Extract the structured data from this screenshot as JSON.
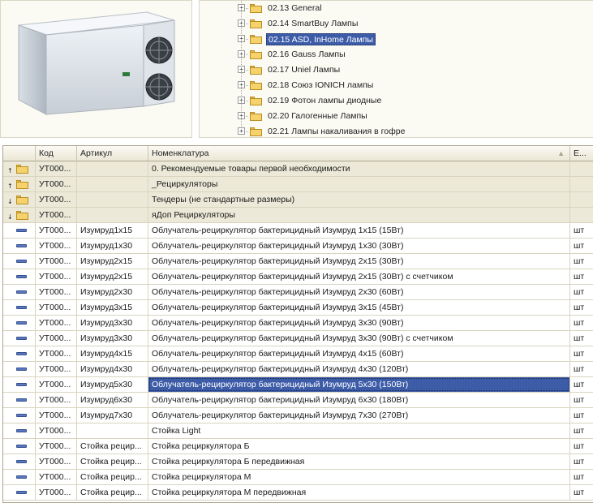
{
  "tree": {
    "items": [
      {
        "label": "02.13 General",
        "selected": false
      },
      {
        "label": "02.14 SmartBuy Лампы",
        "selected": false
      },
      {
        "label": "02.15 ASD, InHome Лампы",
        "selected": true
      },
      {
        "label": "02.16 Gauss Лампы",
        "selected": false
      },
      {
        "label": "02.17 Uniel Лампы",
        "selected": false
      },
      {
        "label": "02.18 Союз IONICH лампы",
        "selected": false
      },
      {
        "label": "02.19 Фотон лампы диодные",
        "selected": false
      },
      {
        "label": "02.20 Галогенные Лампы",
        "selected": false
      },
      {
        "label": "02.21 Лампы накаливания в гофре",
        "selected": false
      }
    ],
    "expander_glyph": "+"
  },
  "grid": {
    "columns": {
      "code": "Код",
      "article": "Артикул",
      "name": "Номенклатура",
      "unit": "Е..."
    },
    "sort_glyph": "▲",
    "rows": [
      {
        "kind": "group-up",
        "code": "УТ000...",
        "article": "",
        "name": "0. Рекомендуемые товары первой необходимости",
        "unit": ""
      },
      {
        "kind": "group-up",
        "code": "УТ000...",
        "article": "",
        "name": "_Рециркуляторы",
        "unit": ""
      },
      {
        "kind": "group-down",
        "code": "УТ000...",
        "article": "",
        "name": "Тендеры (не стандартные размеры)",
        "unit": ""
      },
      {
        "kind": "group-down",
        "code": "УТ000...",
        "article": "",
        "name": "яДоп Рециркуляторы",
        "unit": ""
      },
      {
        "kind": "item",
        "code": "УТ000...",
        "article": "Изумруд1x15",
        "name": "Облучатель-рециркулятор бактерицидный Изумруд 1x15 (15Вт)",
        "unit": "шт"
      },
      {
        "kind": "item",
        "code": "УТ000...",
        "article": "Изумруд1x30",
        "name": "Облучатель-рециркулятор бактерицидный Изумруд 1x30 (30Вт)",
        "unit": "шт"
      },
      {
        "kind": "item",
        "code": "УТ000...",
        "article": "Изумруд2x15",
        "name": "Облучатель-рециркулятор бактерицидный Изумруд 2x15 (30Вт)",
        "unit": "шт"
      },
      {
        "kind": "item",
        "code": "УТ000...",
        "article": "Изумруд2x15",
        "name": "Облучатель-рециркулятор бактерицидный Изумруд 2x15 (30Вт) с счетчиком",
        "unit": "шт"
      },
      {
        "kind": "item",
        "code": "УТ000...",
        "article": "Изумруд2x30",
        "name": "Облучатель-рециркулятор бактерицидный Изумруд 2x30 (60Вт)",
        "unit": "шт"
      },
      {
        "kind": "item",
        "code": "УТ000...",
        "article": "Изумруд3x15",
        "name": "Облучатель-рециркулятор бактерицидный Изумруд 3x15 (45Вт)",
        "unit": "шт"
      },
      {
        "kind": "item",
        "code": "УТ000...",
        "article": "Изумруд3x30",
        "name": "Облучатель-рециркулятор бактерицидный Изумруд 3x30 (90Вт)",
        "unit": "шт"
      },
      {
        "kind": "item",
        "code": "УТ000...",
        "article": "Изумруд3x30",
        "name": "Облучатель-рециркулятор бактерицидный Изумруд 3x30 (90Вт) с счетчиком",
        "unit": "шт"
      },
      {
        "kind": "item",
        "code": "УТ000...",
        "article": "Изумруд4x15",
        "name": "Облучатель-рециркулятор бактерицидный Изумруд 4x15 (60Вт)",
        "unit": "шт"
      },
      {
        "kind": "item",
        "code": "УТ000...",
        "article": "Изумруд4x30",
        "name": "Облучатель-рециркулятор бактерицидный Изумруд 4x30 (120Вт)",
        "unit": "шт"
      },
      {
        "kind": "item",
        "code": "УТ000...",
        "article": "Изумруд5x30",
        "name": "Облучатель-рециркулятор бактерицидный Изумруд 5x30 (150Вт)",
        "unit": "шт",
        "selected": true
      },
      {
        "kind": "item",
        "code": "УТ000...",
        "article": "Изумруд6x30",
        "name": "Облучатель-рециркулятор бактерицидный Изумруд 6x30 (180Вт)",
        "unit": "шт"
      },
      {
        "kind": "item",
        "code": "УТ000...",
        "article": "Изумруд7x30",
        "name": "Облучатель-рециркулятор бактерицидный Изумруд 7x30 (270Вт)",
        "unit": "шт"
      },
      {
        "kind": "item",
        "code": "УТ000...",
        "article": "",
        "name": "Стойка Light",
        "unit": "шт"
      },
      {
        "kind": "item",
        "code": "УТ000...",
        "article": "Стойка рецир...",
        "name": "Стойка рециркулятора Б",
        "unit": "шт"
      },
      {
        "kind": "item",
        "code": "УТ000...",
        "article": "Стойка рецир...",
        "name": "Стойка рециркулятора Б передвижная",
        "unit": "шт"
      },
      {
        "kind": "item",
        "code": "УТ000...",
        "article": "Стойка рецир...",
        "name": "Стойка рециркулятора М",
        "unit": "шт"
      },
      {
        "kind": "item",
        "code": "УТ000...",
        "article": "Стойка рецир...",
        "name": "Стойка рециркулятора М передвижная",
        "unit": "шт"
      }
    ]
  },
  "colors": {
    "selection": "#3d5ca8",
    "group_row": "#ece9d8",
    "folder": "#f5d26b"
  }
}
